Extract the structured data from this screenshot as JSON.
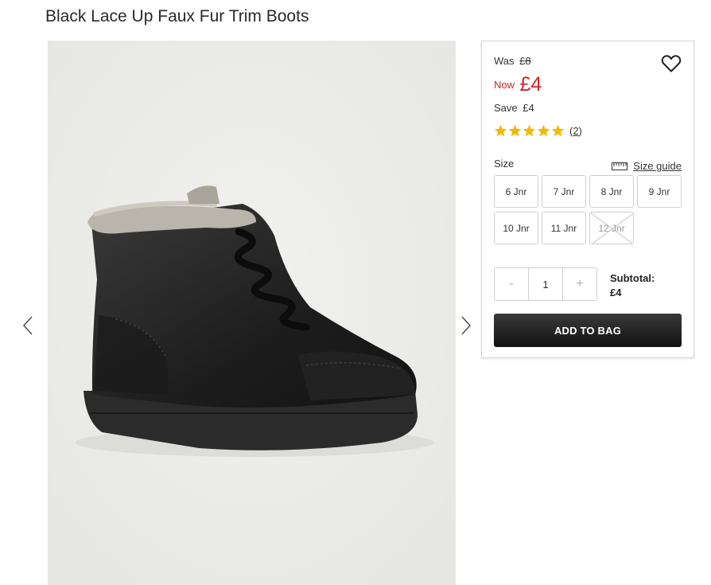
{
  "product": {
    "title": "Black Lace Up Faux Fur Trim Boots"
  },
  "pricing": {
    "was_label": "Was",
    "was_price": "£8",
    "now_label": "Now",
    "now_price": "£4",
    "save_label": "Save",
    "save_amount": "£4",
    "accent_color": "#d2232a"
  },
  "rating": {
    "stars": 5,
    "max_stars": 5,
    "review_count": "(2)",
    "star_color": "#f5b800"
  },
  "size": {
    "label": "Size",
    "guide_label": "Size guide",
    "options": [
      {
        "label": "6 Jnr",
        "available": true
      },
      {
        "label": "7 Jnr",
        "available": true
      },
      {
        "label": "8 Jnr",
        "available": true
      },
      {
        "label": "9 Jnr",
        "available": true
      },
      {
        "label": "10 Jnr",
        "available": true
      },
      {
        "label": "11 Jnr",
        "available": true
      },
      {
        "label": "12 Jnr",
        "available": false
      }
    ]
  },
  "quantity": {
    "minus": "-",
    "value": "1",
    "plus": "+"
  },
  "subtotal": {
    "label": "Subtotal:",
    "value": "£4"
  },
  "actions": {
    "add_to_bag": "ADD TO BAG"
  },
  "icons": {
    "prev": "chevron-left-icon",
    "next": "chevron-right-icon",
    "wishlist": "heart-icon",
    "size_guide": "ruler-icon"
  }
}
